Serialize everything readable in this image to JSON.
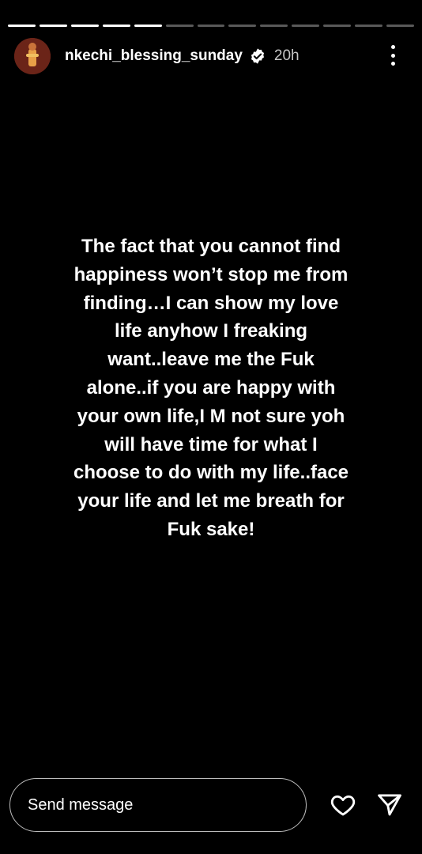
{
  "story": {
    "progress": {
      "total_segments": 13,
      "completed_segments": 5
    },
    "header": {
      "username": "nkechi_blessing_sunday",
      "time_ago": "20h",
      "verified": true
    },
    "text": "The fact that you cannot find happiness won’t stop me from finding…I can show my love life anyhow I freaking want..leave me the Fuk alone..if you are happy with your own life,I M not sure yoh will have time for what I choose to do with my life..face your life and let me breath for Fuk sake!"
  },
  "footer": {
    "message_placeholder": "Send message"
  },
  "icons": [
    "verified-badge-icon",
    "more-options-icon",
    "heart-icon",
    "send-icon"
  ],
  "colors": {
    "background": "#000000",
    "text": "#ffffff",
    "secondary_text": "#c7c7c7"
  }
}
